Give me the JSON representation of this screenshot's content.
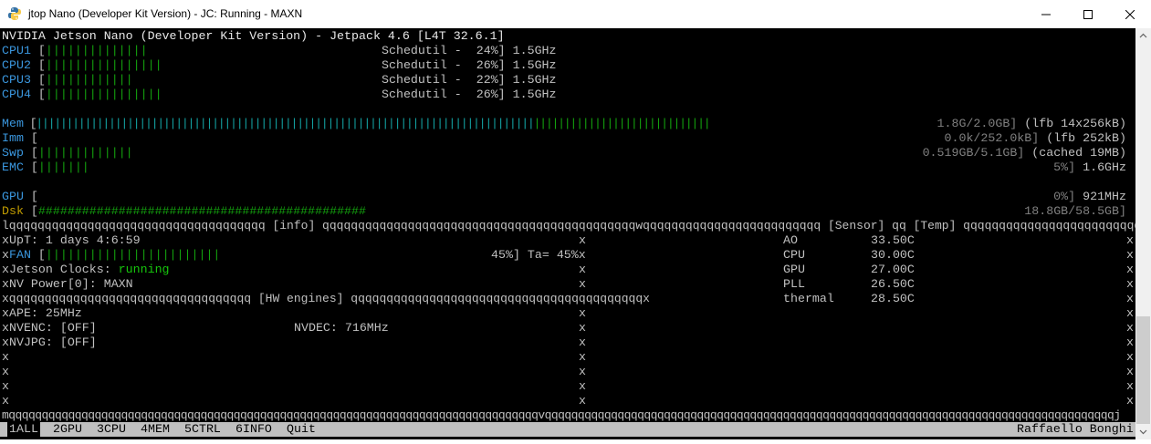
{
  "window": {
    "title": "jtop Nano (Developer Kit Version) - JC: Running - MAXN",
    "icons": [
      "python-icon",
      "minimize-icon",
      "maximize-icon",
      "close-icon"
    ]
  },
  "header": "NVIDIA Jetson Nano (Developer Kit Version) - Jetpack 4.6 [L4T 32.6.1]",
  "cpus": [
    {
      "name": "CPU1",
      "bar": "||||||||||||||",
      "gov": "Schedutil -  24%]",
      "freq": "1.5GHz"
    },
    {
      "name": "CPU2",
      "bar": "||||||||||||||||",
      "gov": "Schedutil -  26%]",
      "freq": "1.5GHz"
    },
    {
      "name": "CPU3",
      "bar": "||||||||||||",
      "gov": "Schedutil -  22%]",
      "freq": "1.5GHz"
    },
    {
      "name": "CPU4",
      "bar": "||||||||||||||||",
      "gov": "Schedutil -  26%]",
      "freq": "1.5GHz"
    }
  ],
  "mem": {
    "name": "Mem",
    "bar_cyan": "||||||||||||||||||||||||||||||||||||||||||||||||||||||||||||||||||||||||||||||||||",
    "bar_green": "|||||||||||||||||||||||||||||",
    "value": "1.8G/2.0GB]",
    "extra": "(lfb 14x256kB)"
  },
  "imm": {
    "name": "Imm",
    "value": "0.0k/252.0kB]",
    "extra": "(lfb 252kB)"
  },
  "swp": {
    "name": "Swp",
    "bar": "|||||||||||||",
    "value": "0.519GB/5.1GB]",
    "extra": "(cached 19MB)"
  },
  "emc": {
    "name": "EMC",
    "bar": "|||||||",
    "value": "5%]",
    "extra": "1.6GHz"
  },
  "gpu": {
    "name": "GPU",
    "value": "0%]",
    "extra": "921MHz"
  },
  "dsk": {
    "name": "Dsk",
    "bar": "#############################################",
    "value": "18.8GB/58.5GB]"
  },
  "box": {
    "top_line": "lqqqqqqqqqqqqqqqqqqqqqqqqqqqqqqqqqqqq [info] qqqqqqqqqqqqqqqqqqqqqqqqqqqqqqqqqqqqqqqqqqqqwqqqqqqqqqqqqqqqqqqqqqqqqq [Sensor] qq [Temp] qqqqqqqqqqqqqqqqqqqqqqqqqqqqqqqqqqqk",
    "hw_line": "xqqqqqqqqqqqqqqqqqqqqqqqqqqqqqqqqqq [HW engines] qqqqqqqqqqqqqqqqqqqqqqqqqqqqqqqqqqqqqqqqqx",
    "bottom_line": "mqqqqqqqqqqqqqqqqqqqqqqqqqqqqqqqqqqqqqqqqqqqqqqqqqqqqqqqqqqqqqqqqqqqqqqqqqqqqqqqqvqqqqqqqqqqqqqqqqqqqqqqqqqqqqqqqqqqqqqqqqqqqqqqqqqqqqqqqqqqqqqqqqqqqqqqqqqqqqqqqqqqqqqqj",
    "edge": "x"
  },
  "info": {
    "uptime": "xUpT: 1 days 4:6:59",
    "fan_label": "FAN",
    "fan_bar": "||||||||||||||||||||||||",
    "fan_value": "45%] Ta= 45%",
    "jc_label": "xJetson Clocks: ",
    "jc_value": "running",
    "nvp": "xNV Power[0]: MAXN"
  },
  "hw": {
    "ape": "xAPE: 25MHz",
    "nvenc": "xNVENC: [OFF]",
    "nvdec": "NVDEC: 716MHz",
    "nvjpg": "xNVJPG: [OFF]"
  },
  "sensors": [
    {
      "name": "AO",
      "temp": "33.50C"
    },
    {
      "name": "CPU",
      "temp": "30.00C"
    },
    {
      "name": "GPU",
      "temp": "27.00C"
    },
    {
      "name": "PLL",
      "temp": "26.50C"
    },
    {
      "name": "thermal",
      "temp": "28.50C"
    }
  ],
  "tabs": [
    {
      "num": "1",
      "label": "ALL"
    },
    {
      "num": "2",
      "label": "GPU"
    },
    {
      "num": "3",
      "label": "CPU"
    },
    {
      "num": "4",
      "label": "MEM"
    },
    {
      "num": "5",
      "label": "CTRL"
    },
    {
      "num": "6",
      "label": "INFO"
    },
    {
      "num": "",
      "label": "Quit"
    }
  ],
  "author": "Raffaello Bonghi"
}
